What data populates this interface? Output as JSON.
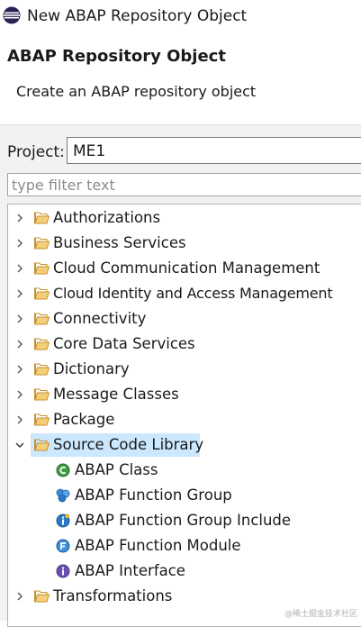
{
  "window": {
    "title": "New ABAP Repository Object"
  },
  "header": {
    "title": "ABAP Repository Object",
    "subtitle": "Create an ABAP repository object"
  },
  "project": {
    "label": "Project:",
    "value": "ME1"
  },
  "filter": {
    "placeholder": "type filter text"
  },
  "tree": {
    "items": [
      {
        "label": "Authorizations",
        "expanded": false
      },
      {
        "label": "Business Services",
        "expanded": false
      },
      {
        "label": "Cloud Communication Management",
        "expanded": false
      },
      {
        "label": "Cloud Identity and Access Management",
        "expanded": false
      },
      {
        "label": "Connectivity",
        "expanded": false
      },
      {
        "label": "Core Data Services",
        "expanded": false
      },
      {
        "label": "Dictionary",
        "expanded": false
      },
      {
        "label": "Message Classes",
        "expanded": false
      },
      {
        "label": "Package",
        "expanded": false
      },
      {
        "label": "Source Code Library",
        "expanded": true,
        "selected": true,
        "children": [
          {
            "label": "ABAP Class",
            "icon": "abap-class-icon"
          },
          {
            "label": "ABAP Function Group",
            "icon": "abap-function-group-icon"
          },
          {
            "label": "ABAP Function Group Include",
            "icon": "abap-function-group-include-icon"
          },
          {
            "label": "ABAP Function Module",
            "icon": "abap-function-module-icon"
          },
          {
            "label": "ABAP Interface",
            "icon": "abap-interface-icon"
          }
        ]
      },
      {
        "label": "Transformations",
        "expanded": false
      }
    ]
  },
  "watermark": "@稀土掘金技术社区",
  "colors": {
    "selection": "#cce8ff",
    "folder": "#e8b04a",
    "class_icon": "#3f9b3f",
    "info_icon": "#2a78c8",
    "interface_icon": "#6a4fb0"
  }
}
